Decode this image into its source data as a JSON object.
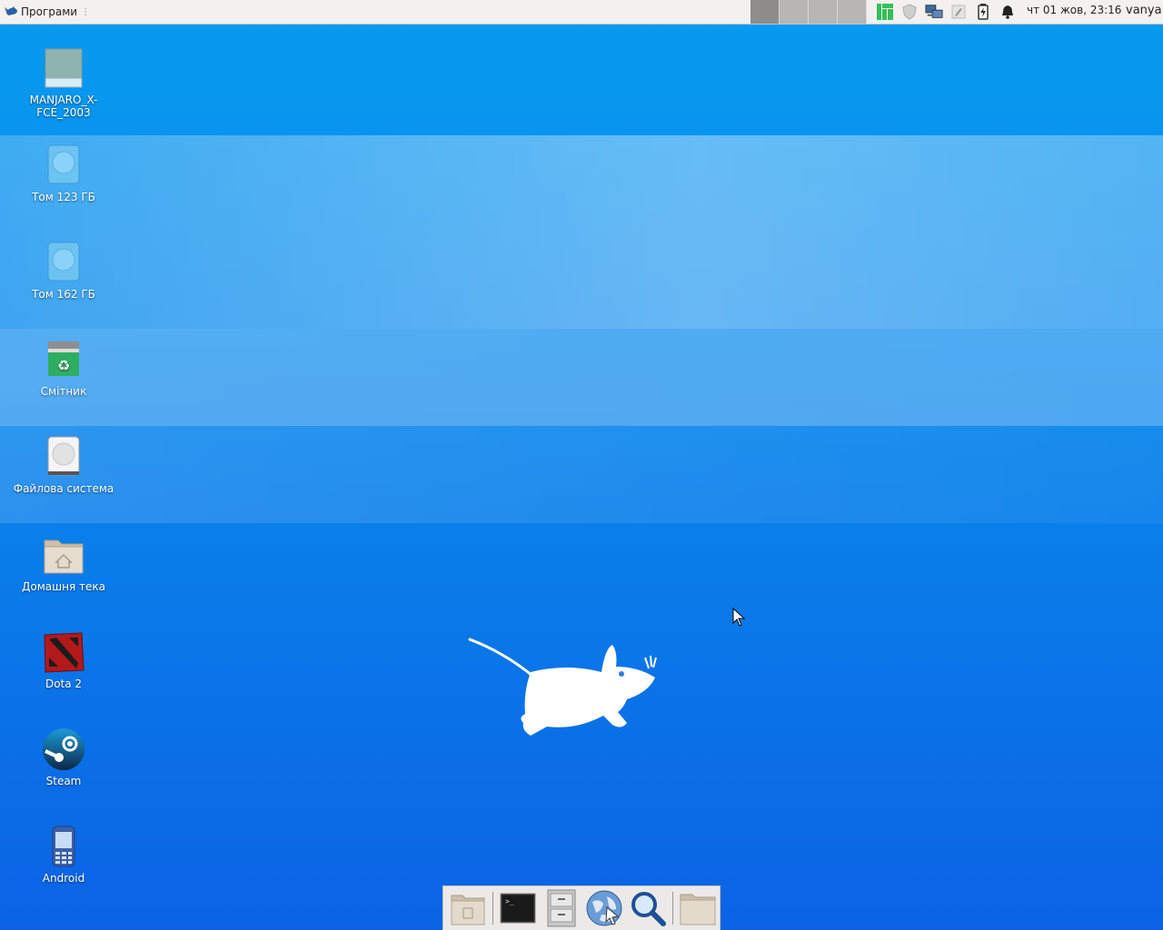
{
  "panel": {
    "apps_label": "Програми",
    "workspaces": [
      "workspace-1",
      "workspace-2",
      "workspace-3",
      "workspace-4"
    ],
    "tray_icons": [
      "manjaro-icon",
      "shield-icon",
      "network-icon",
      "pen-icon",
      "battery-icon",
      "bell-icon"
    ],
    "clock": "чт 01 жов, 23:16",
    "user": "vanya"
  },
  "desktop": {
    "icons": [
      {
        "label": "MANJARO_X-FCE_2003",
        "icon": "drive-icon"
      },
      {
        "label": "Том 123 ГБ",
        "icon": "volume-icon"
      },
      {
        "label": "Том 162 ГБ",
        "icon": "volume-icon"
      },
      {
        "label": "Смітник",
        "icon": "trash-icon"
      },
      {
        "label": "Файлова система",
        "icon": "harddisk-icon"
      },
      {
        "label": "Домашня тека",
        "icon": "home-folder-icon"
      },
      {
        "label": "Dota 2",
        "icon": "dota-icon"
      },
      {
        "label": "Steam",
        "icon": "steam-icon"
      },
      {
        "label": "Android",
        "icon": "phone-icon"
      }
    ]
  },
  "dock": {
    "items": [
      "show-desktop-icon",
      "terminal-icon",
      "file-manager-icon",
      "web-browser-icon",
      "search-icon",
      "folder-icon"
    ]
  },
  "colors": {
    "accent": "#0b86ec",
    "panel_bg": "#f2f1f0"
  }
}
